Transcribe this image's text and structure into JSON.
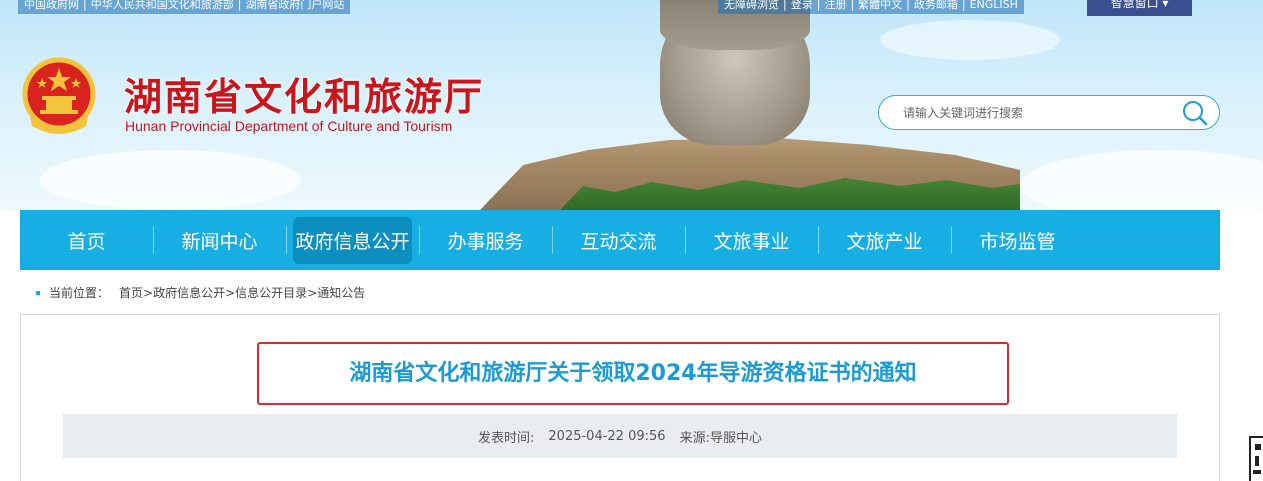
{
  "topbar": {
    "left_links": [
      "中国政府网",
      "中华人民共和国文化和旅游部",
      "湖南省政府门户网站"
    ],
    "right_links": [
      "无障碍浏览",
      "登录",
      "注册",
      "繁體中文",
      "政务邮箱",
      "ENGLISH"
    ],
    "lang_button": "智慧窗口"
  },
  "header": {
    "title": "湖南省文化和旅游厅",
    "subtitle": "Hunan Provincial Department of Culture and Tourism"
  },
  "search": {
    "placeholder": "请输入关键词进行搜索"
  },
  "nav": {
    "items": [
      "首页",
      "新闻中心",
      "政府信息公开",
      "办事服务",
      "互动交流",
      "文旅事业",
      "文旅产业",
      "市场监管"
    ],
    "active_index": 2
  },
  "breadcrumb": {
    "label": "当前位置：",
    "items": [
      "首页",
      "政府信息公开",
      "信息公开目录",
      "通知公告"
    ],
    "separator": ">"
  },
  "article": {
    "title": "湖南省文化和旅游厅关于领取2024年导游资格证书的通知",
    "publish_label": "发表时间:",
    "publish_time": "2025-04-22 09:56",
    "source_label": "来源:",
    "source": "导服中心"
  },
  "colors": {
    "nav_bg": "#17aee3",
    "nav_active": "#0c8fc0",
    "title_red": "#c8161d",
    "article_title_blue": "#1a9bd6",
    "highlight_border": "#e0282e"
  }
}
